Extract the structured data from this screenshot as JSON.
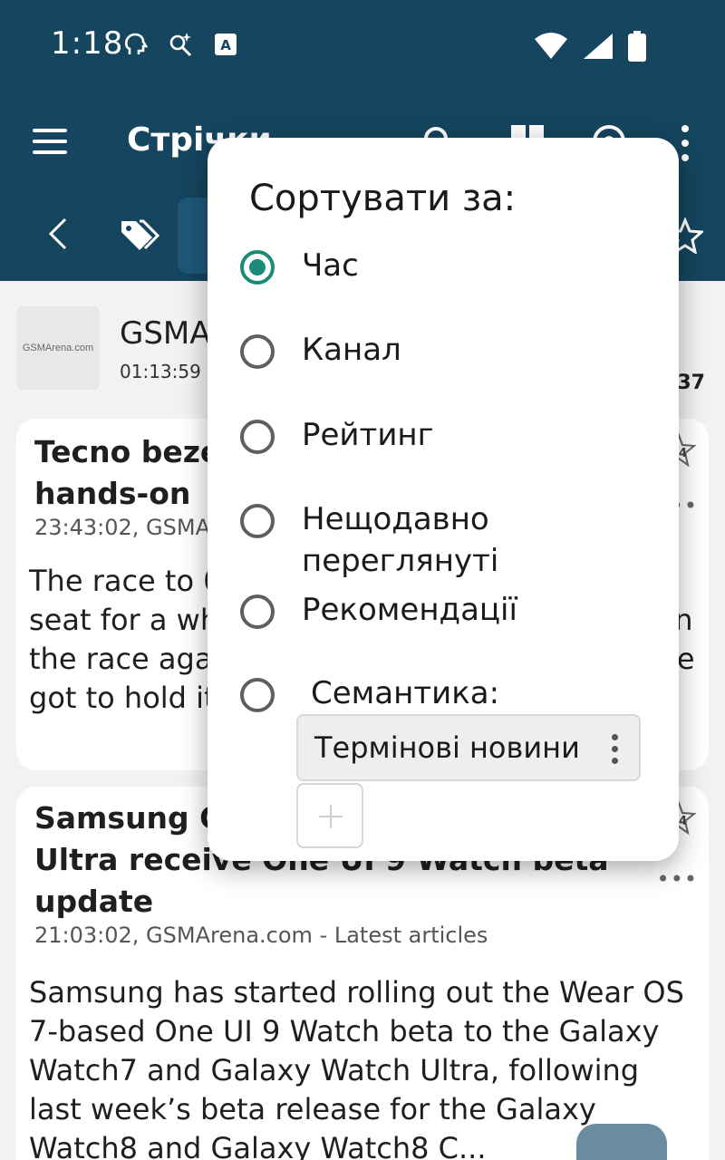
{
  "status_bar": {
    "time": "1:18",
    "icons": [
      "brain-icon",
      "sparkle-icon",
      "a-box-icon",
      "wifi-icon",
      "signal-icon",
      "battery-icon"
    ]
  },
  "toolbar": {
    "title": "Стрічки",
    "icons": [
      "menu-icon",
      "search-icon",
      "grid-icon",
      "eye-icon",
      "more-vert-icon"
    ]
  },
  "subbar": {
    "icons": [
      "chevron-left-icon",
      "tags-icon",
      "star-icon"
    ]
  },
  "feed": {
    "name": "GSMArena.com",
    "logo_text": "GSMArena.com",
    "time": "01:13:59",
    "count": "37"
  },
  "articles": [
    {
      "title": "Tecno bezel-less concept phone hands-on",
      "meta": "23:43:02, GSMArena.com - Latest articles",
      "body": "The race to 0 bezels has been taking a back seat for a while. But Tecno decided to jump in the race again with its bezel-less concept. We got to hold it in person.",
      "badge": "24"
    },
    {
      "title": "Samsung Galaxy Watch7 and Watch Ultra receive One UI 9 Watch beta update",
      "meta": "21:03:02, GSMArena.com - Latest articles",
      "body": "Samsung has started rolling out the Wear OS 7-based One UI 9 Watch beta to the Galaxy Watch7 and Galaxy Watch Ultra, following last week’s beta release for the Galaxy Watch8 and Galaxy Watch8 C...",
      "badge": "24"
    }
  ],
  "sort_dialog": {
    "title": "Сортувати за:",
    "options": [
      {
        "label": "Час",
        "selected": true
      },
      {
        "label": "Канал",
        "selected": false
      },
      {
        "label": "Рейтинг",
        "selected": false
      },
      {
        "label": "Нещодавно переглянуті",
        "selected": false
      },
      {
        "label": "Рекомендації",
        "selected": false
      },
      {
        "label": "Семантика:",
        "selected": false
      }
    ],
    "semantic_chip": "Термінові новини",
    "accent_color": "#1b8a78"
  },
  "colors": {
    "appbar": "#15455f",
    "background": "#f2f2f2"
  }
}
